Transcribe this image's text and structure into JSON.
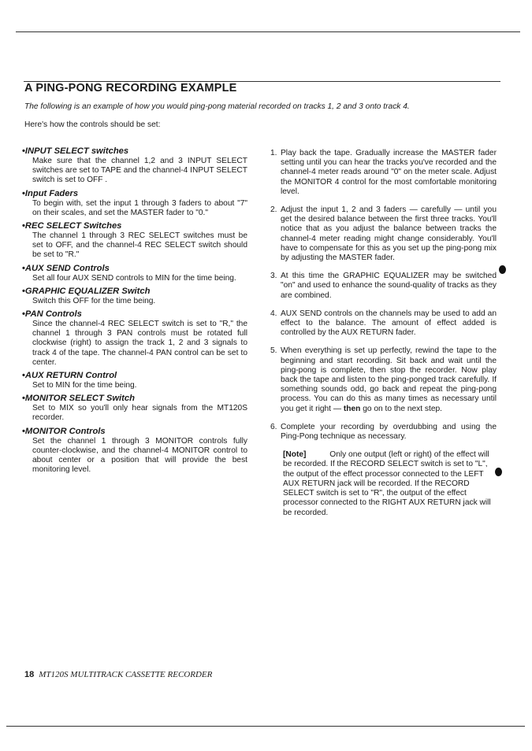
{
  "section": {
    "title": "A PING-PONG RECORDING EXAMPLE",
    "intro": "The following is an example of how you would ping-pong material recorded on tracks 1, 2 and 3 onto track 4.",
    "lead": "Here's how the controls should be set:"
  },
  "controls": [
    {
      "bullet": "•",
      "heading": "INPUT SELECT switches",
      "text": "Make sure that the channel 1,2 and 3 INPUT SELECT switches are set to TAPE and the channel-4 INPUT SELECT switch is set to OFF ."
    },
    {
      "bullet": "•",
      "heading": "Input Faders",
      "text": "To begin with, set the input 1 through 3 faders to about \"7\" on their scales, and set the MASTER fader to \"0.\""
    },
    {
      "bullet": "•",
      "heading": "REC SELECT Switches",
      "text": "The channel 1 through 3 REC SELECT switches must be set to OFF, and the channel-4 REC SELECT switch should be set to \"R.\""
    },
    {
      "bullet": "•",
      "heading": "AUX SEND Controls",
      "text": "Set all four AUX SEND controls to MIN for the time being."
    },
    {
      "bullet": "•",
      "heading": "GRAPHIC EQUALIZER Switch",
      "text": "Switch this OFF for the time being."
    },
    {
      "bullet": "•",
      "heading": "PAN Controls",
      "text": "Since the channel-4 REC SELECT switch is set to \"R,\" the channel 1 through 3 PAN controls must be rotated full clockwise (right) to assign the track 1, 2 and 3 signals to track 4 of the tape. The channel-4 PAN control can be set to center."
    },
    {
      "bullet": "•",
      "heading": "AUX RETURN Control",
      "text": "Set to MIN for the time being."
    },
    {
      "bullet": "•",
      "heading": "MONITOR SELECT Switch",
      "text": "Set to MIX so you'll only hear signals from the MT120S recorder."
    },
    {
      "bullet": "•",
      "heading": "MONITOR Controls",
      "text": "Set the channel 1 through 3 MONITOR controls fully counter-clockwise, and the channel-4 MONITOR control to about center or a position that will provide the best monitoring level."
    }
  ],
  "steps": [
    {
      "num": "1.",
      "text": "Play back the tape. Gradually increase the MASTER fader setting until you can hear the tracks you've recorded and the channel-4 meter reads around \"0\" on the meter scale. Adjust the MONITOR 4 control for the most comfortable monitoring level."
    },
    {
      "num": "2.",
      "text": "Adjust the input 1, 2 and 3 faders — carefully — until you get the desired balance between the first three tracks. You'll notice that as you adjust the balance between tracks the channel-4 meter reading might change considerably. You'll have to compensate for this as you set up the ping-pong mix by adjusting the MASTER fader."
    },
    {
      "num": "3.",
      "text": "At this time the GRAPHIC EQUALIZER may be switched \"on\" and used to enhance the sound-quality of tracks as they are combined."
    },
    {
      "num": "4.",
      "text": "AUX SEND controls on the channels may be used to add an effect to the balance. The amount of effect added is controlled by the AUX RETURN fader."
    },
    {
      "num": "5.",
      "text_before": "When everything is set up perfectly, rewind the tape to the beginning and start recording. Sit back and wait until the ping-pong is complete, then stop the recorder. Now play back the tape and listen to the ping-ponged track carefully. If something sounds odd, go back and repeat the ping-pong process. You can do this as many times as necessary until you get it right — ",
      "text_bold": "then",
      "text_after": " go on to the next step."
    },
    {
      "num": "6.",
      "text": "Complete your recording by overdubbing and using the Ping-Pong technique as necessary."
    }
  ],
  "note": {
    "label": "[Note]",
    "text": "Only one output (left or right) of the effect will be recorded. If the RECORD SELECT switch is set to \"L\", the output of the effect processor connected to the LEFT AUX RETURN jack will be recorded. If the RECORD SELECT switch is set to \"R\", the output of the effect processor connected to the RIGHT AUX RETURN jack will be recorded."
  },
  "footer": {
    "page_number": "18",
    "title": "MT120S MULTITRACK CASSETTE RECORDER"
  }
}
